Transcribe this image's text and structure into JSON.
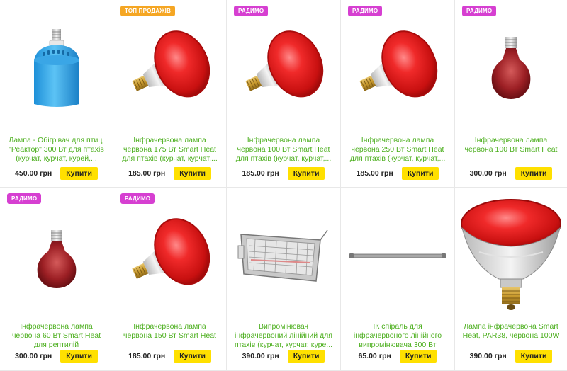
{
  "currency_button": "Купити",
  "products": [
    {
      "badge": "",
      "title": "Лампа - Обігрівач для птиці \"Реактор\" 300 Вт для птахів (курчат, курчат, курей,...",
      "price": "450.00 грн",
      "buy": "Купити",
      "image": "blue-heater-lamp"
    },
    {
      "badge": "ТОП ПРОДАЖІВ",
      "title": "Інфрачервона лампа червона 175 Вт Smart Heat для птахів (курчат, курчат,...",
      "price": "185.00 грн",
      "buy": "Купити",
      "image": "red-par-lamp"
    },
    {
      "badge": "РАДИМО",
      "title": "Інфрачервона лампа червона 100 Вт Smart Heat для птахів (курчат, курчат,...",
      "price": "185.00 грн",
      "buy": "Купити",
      "image": "red-par-lamp"
    },
    {
      "badge": "РАДИМО",
      "title": "Інфрачервона лампа червона 250 Вт Smart Heat для птахів (курчат, курчат,...",
      "price": "185.00 грн",
      "buy": "Купити",
      "image": "red-par-lamp"
    },
    {
      "badge": "РАДИМО",
      "title": "Інфрачервона лампа червона 100 Вт Smart Heat",
      "price": "300.00 грн",
      "buy": "Купити",
      "image": "small-red-lamp"
    },
    {
      "badge": "РАДИМО",
      "title": "Інфрачервона лампа червона 60 Вт Smart Heat для рептилій",
      "price": "300.00 грн",
      "buy": "Купити",
      "image": "small-red-lamp"
    },
    {
      "badge": "РАДИМО",
      "title": "Інфрачервона лампа червона 150 Вт Smart Heat",
      "price": "185.00 грн",
      "buy": "Купити",
      "image": "red-par-lamp"
    },
    {
      "badge": "",
      "title": "Випромінювач інфрачервоний лінійний для птахів (курчат, курчат, курe...",
      "price": "390.00 грн",
      "buy": "Купити",
      "image": "linear-emitter"
    },
    {
      "badge": "",
      "title": "ІК спіраль для інфрачервоного лінійного випромінювача 300 Вт",
      "price": "65.00 грн",
      "buy": "Купити",
      "image": "ir-spiral-rod"
    },
    {
      "badge": "",
      "title": "Лампа інфрачервона Smart Heat, PAR38, червона 100W",
      "price": "390.00 грн",
      "buy": "Купити",
      "image": "large-par38-lamp"
    }
  ],
  "colors": {
    "title_green": "#4caf1e",
    "buy_yellow": "#ffe000",
    "badge_top": "#f5a623",
    "badge_recommend": "#d63fd1"
  }
}
